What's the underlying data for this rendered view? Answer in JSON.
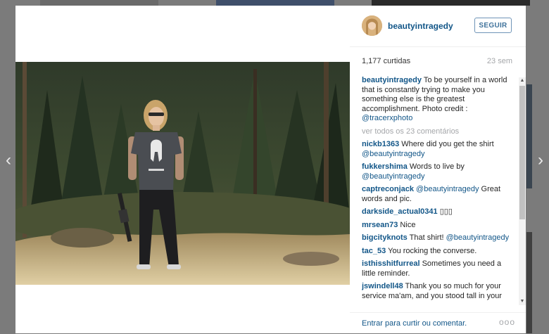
{
  "post": {
    "username": "beautyintragedy",
    "follow_label": "SEGUIR",
    "likes": "1,177 curtidas",
    "age": "23 sem",
    "caption_user": "beautyintragedy",
    "caption_text": " To be yourself in a world that is constantly trying to make you something else is the greatest accomplishment. Photo credit : ",
    "caption_mention": "@tracerxphoto",
    "view_all": "ver todos os 23 comentários",
    "login_prompt": "Entrar para curtir ou comentar.",
    "more_options": "ooo"
  },
  "comments": [
    {
      "user": "nickb1363",
      "text": " Where did you get the shirt ",
      "mention": "@beautyintragedy",
      "tail": ""
    },
    {
      "user": "fukkershima",
      "text": " Words to live by ",
      "mention": "@beautyintragedy",
      "tail": ""
    },
    {
      "user": "captreconjack",
      "text": " ",
      "mention": "@beautyintragedy",
      "tail": " Great words and pic."
    },
    {
      "user": "darkside_actual0341",
      "text": " ▯▯▯",
      "mention": "",
      "tail": ""
    },
    {
      "user": "mrsean73",
      "text": " Nice",
      "mention": "",
      "tail": ""
    },
    {
      "user": "bigcityknots",
      "text": " That shirt! ",
      "mention": "@beautyintragedy",
      "tail": ""
    },
    {
      "user": "tac_53",
      "text": " You rocking the converse.",
      "mention": "",
      "tail": ""
    },
    {
      "user": "isthisshitfurreal",
      "text": " Sometimes you need a little reminder.",
      "mention": "",
      "tail": ""
    },
    {
      "user": "jswindell48",
      "text": " Thank you so much for your service ma'am, and you stood tall in your",
      "mention": "",
      "tail": ""
    }
  ],
  "nav": {
    "prev": "‹",
    "next": "›"
  },
  "scroll": {
    "up": "▲",
    "down": "▼"
  },
  "icons": {
    "prev": "chevron-left-icon",
    "next": "chevron-right-icon"
  },
  "colors": {
    "link": "#125688",
    "muted": "#a5a7aa",
    "follow_border": "#6e94b7"
  }
}
